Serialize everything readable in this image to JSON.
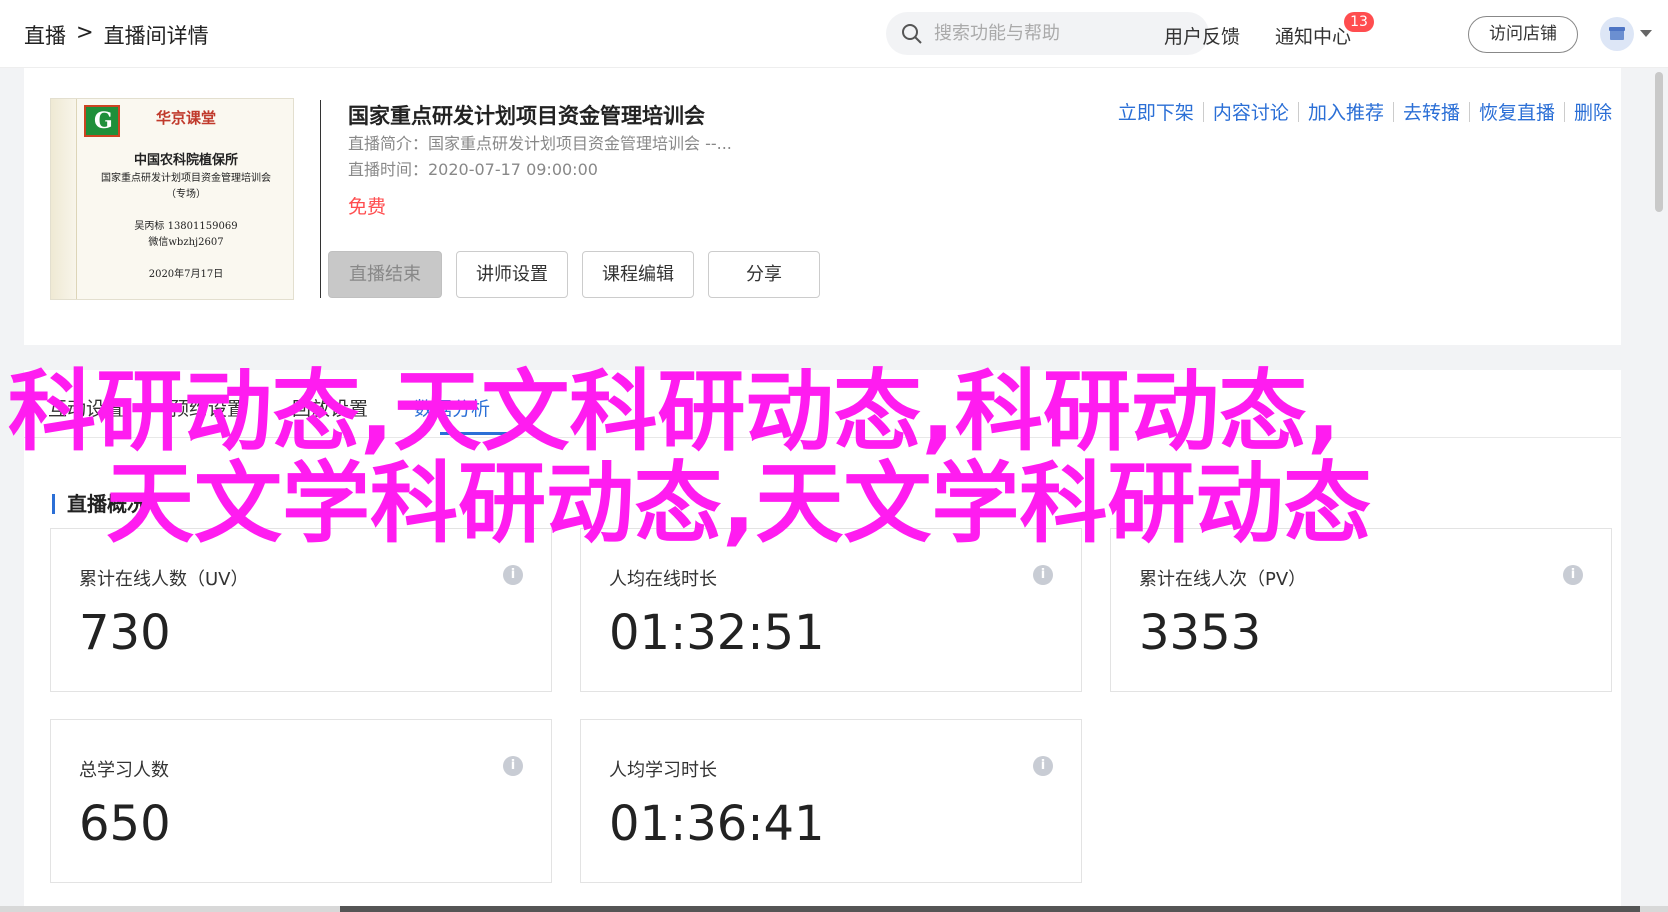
{
  "header": {
    "breadcrumb": [
      "直播",
      ">",
      "直播间详情"
    ],
    "search_placeholder": "搜索功能与帮助",
    "feedback": "用户反馈",
    "notifications": "通知中心",
    "notification_count": "13",
    "visit_store": "访问店铺"
  },
  "course": {
    "title": "国家重点研发计划项目资金管理培训会",
    "intro": "直播简介：国家重点研发计划项目资金管理培训会 --...",
    "time": "直播时间：2020-07-17 09:00:00",
    "price": "免费",
    "poster": {
      "brand": "华京课堂",
      "org": "中国农科院植保所",
      "subject": "国家重点研发计划项目资金管理培训会",
      "tag": "（专场）",
      "contact_phone": "吴丙标 13801159069",
      "contact_wechat": "微信wbzhj2607",
      "date": "2020年7月17日"
    },
    "buttons": {
      "end_live": "直播结束",
      "lecturer": "讲师设置",
      "edit": "课程编辑",
      "share": "分享"
    },
    "ops": [
      "立即下架",
      "内容讨论",
      "加入推荐",
      "去转播",
      "恢复直播",
      "删除"
    ]
  },
  "tabs": [
    "互动设置",
    "预约设置",
    "回放设置",
    "数据分析"
  ],
  "overview": {
    "title": "直播概况",
    "stats": [
      {
        "label": "累计在线人数（UV）",
        "value": "730"
      },
      {
        "label": "人均在线时长",
        "value": "01:32:51"
      },
      {
        "label": "累计在线人次（PV）",
        "value": "3353"
      },
      {
        "label": "总学习人数",
        "value": "650"
      },
      {
        "label": "人均学习时长",
        "value": "01:36:41"
      }
    ]
  },
  "watermark": {
    "line1": "科研动态,天文科研动态,科研动态,",
    "line2": "天文学科研动态,天文学科研动态",
    "color": "#ff1cf0"
  }
}
